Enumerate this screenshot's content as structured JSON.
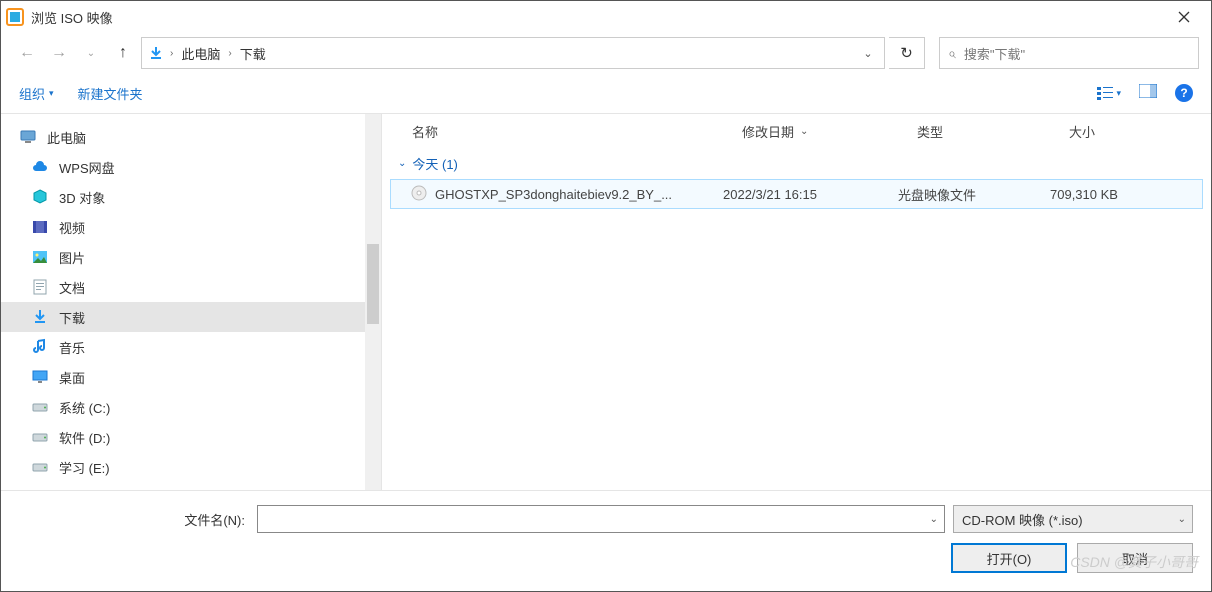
{
  "window": {
    "title": "浏览 ISO 映像"
  },
  "nav": {
    "breadcrumbs": [
      "此电脑",
      "下载"
    ],
    "search_placeholder": "搜索\"下载\""
  },
  "toolbar": {
    "organize": "组织",
    "newfolder": "新建文件夹"
  },
  "sidebar": {
    "root": "此电脑",
    "items": [
      {
        "label": "WPS网盘",
        "icon": "cloud"
      },
      {
        "label": "3D 对象",
        "icon": "cube"
      },
      {
        "label": "视频",
        "icon": "video"
      },
      {
        "label": "图片",
        "icon": "image"
      },
      {
        "label": "文档",
        "icon": "doc"
      },
      {
        "label": "下载",
        "icon": "download",
        "selected": true
      },
      {
        "label": "音乐",
        "icon": "music"
      },
      {
        "label": "桌面",
        "icon": "desktop"
      },
      {
        "label": "系统 (C:)",
        "icon": "drive"
      },
      {
        "label": "软件 (D:)",
        "icon": "drive"
      },
      {
        "label": "学习 (E:)",
        "icon": "drive"
      }
    ]
  },
  "columns": {
    "name": "名称",
    "date": "修改日期",
    "type": "类型",
    "size": "大小"
  },
  "group": {
    "label": "今天 (1)"
  },
  "files": [
    {
      "name": "GHOSTXP_SP3donghaitebiev9.2_BY_...",
      "date": "2022/3/21 16:15",
      "type": "光盘映像文件",
      "size": "709,310 KB"
    }
  ],
  "footer": {
    "filename_label": "文件名(N):",
    "filename_value": "",
    "filter": "CD-ROM 映像 (*.iso)",
    "open": "打开(O)",
    "cancel": "取消"
  },
  "watermark": "CSDN @龚子小哥哥"
}
